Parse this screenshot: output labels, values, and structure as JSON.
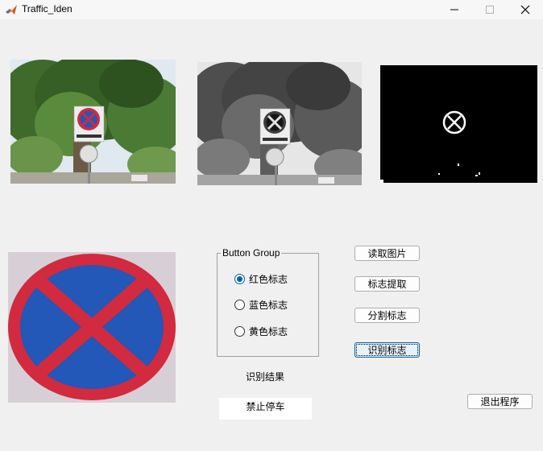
{
  "window": {
    "title": "Traffic_Iden",
    "icons": {
      "app": "matlab-icon",
      "minimize": "minimize-icon",
      "maximize": "maximize-icon",
      "close": "close-icon"
    }
  },
  "axes": {
    "original": "original-photo",
    "grayscale": "grayscale-photo",
    "binary": "binary-mask",
    "extracted": "extracted-sign"
  },
  "button_group": {
    "title": "Button Group",
    "options": [
      {
        "label": "红色标志",
        "checked": true
      },
      {
        "label": "蓝色标志",
        "checked": false
      },
      {
        "label": "黄色标志",
        "checked": false
      }
    ]
  },
  "buttons": {
    "read_image": "读取图片",
    "extract_sign": "标志提取",
    "segment_sign": "分割标志",
    "identify_sign": "识别标志",
    "exit_program": "退出程序"
  },
  "result": {
    "label": "识别结果",
    "value": "禁止停车"
  },
  "colors": {
    "sign_red": "#d22a3e",
    "sign_blue": "#2357b8",
    "focus_blue": "#0063b1"
  }
}
